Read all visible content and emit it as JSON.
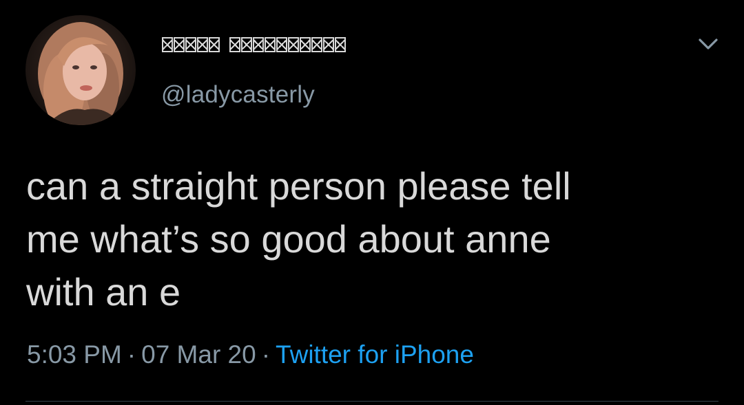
{
  "tweet": {
    "display_name_word1": "▯▯▯▯▯",
    "display_name_word2": "▯▯▯▯▯▯▯▯▯▯",
    "handle": "@ladycasterly",
    "text": "can a straight person please tell\nme what’s so good about anne\nwith an e",
    "time": "5:03 PM",
    "date": "07 Mar 20",
    "source": "Twitter for iPhone",
    "separator": "·"
  },
  "icons": {
    "menu": "chevron-down-icon",
    "avatar": "profile-photo"
  },
  "colors": {
    "background": "#000000",
    "text": "#d9d9d9",
    "secondary": "#8899a6",
    "link": "#1da1f2"
  }
}
